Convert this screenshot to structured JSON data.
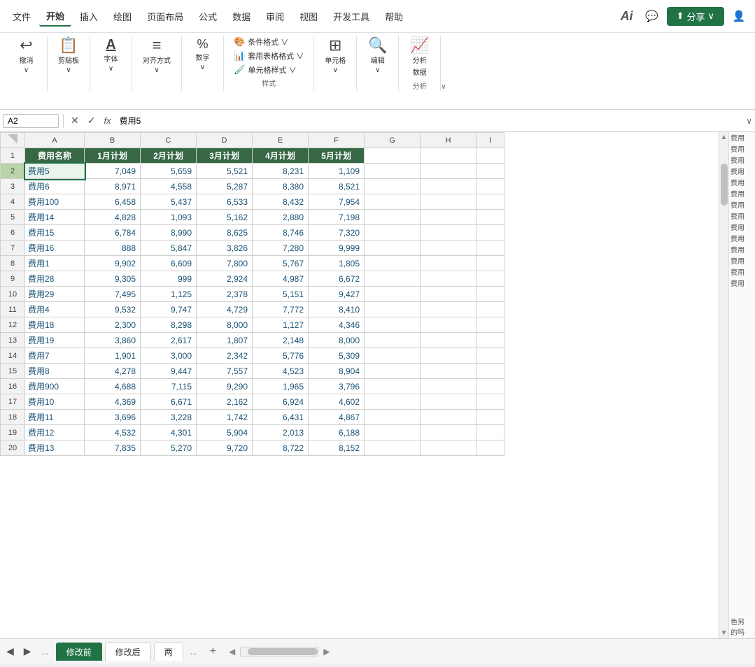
{
  "titlebar": {
    "menu_items": [
      "文件",
      "开始",
      "插入",
      "绘图",
      "页面布局",
      "公式",
      "数据",
      "审阅",
      "视图",
      "开发工具",
      "帮助"
    ],
    "active_menu": "开始",
    "ai_label": "Ai",
    "share_label": "分享",
    "user_icon": "👤"
  },
  "ribbon": {
    "groups": [
      {
        "id": "undo",
        "label": "撤消",
        "items": [
          {
            "icon": "↩",
            "label": "撤消"
          }
        ]
      },
      {
        "id": "clipboard",
        "label": "剪贴板",
        "items": [
          {
            "icon": "📋",
            "label": "剪贴板"
          }
        ]
      },
      {
        "id": "font",
        "label": "字体",
        "items": [
          {
            "icon": "A",
            "label": "字体"
          }
        ]
      },
      {
        "id": "alignment",
        "label": "对齐方式",
        "items": [
          {
            "icon": "≡",
            "label": "对齐方式"
          }
        ]
      },
      {
        "id": "number",
        "label": "数字",
        "items": [
          {
            "icon": "%",
            "label": "数字"
          }
        ]
      },
      {
        "id": "styles",
        "label": "样式",
        "rows": [
          {
            "icon": "🎨",
            "label": "条件格式 ∨"
          },
          {
            "icon": "📊",
            "label": "套用表格格式 ∨"
          },
          {
            "icon": "🖌",
            "label": "单元格样式 ∨"
          }
        ]
      },
      {
        "id": "cells",
        "label": "单元格",
        "items": [
          {
            "icon": "⊞",
            "label": "单元格"
          }
        ]
      },
      {
        "id": "editing",
        "label": "编辑",
        "items": [
          {
            "icon": "🔍",
            "label": "编辑"
          }
        ]
      },
      {
        "id": "analysis",
        "label": "分析",
        "items": [
          {
            "icon": "📈",
            "label": "分析数据"
          }
        ]
      }
    ]
  },
  "formula_bar": {
    "cell_ref": "A2",
    "formula_value": "费用5",
    "fx_label": "fx"
  },
  "spreadsheet": {
    "col_headers": [
      "A",
      "B",
      "C",
      "D",
      "E",
      "F",
      "G",
      "H",
      "I"
    ],
    "row_count": 20,
    "headers": [
      "费用名称",
      "1月计划",
      "2月计划",
      "3月计划",
      "4月计划",
      "5月计划"
    ],
    "rows": [
      [
        "费用5",
        "7,049",
        "5,659",
        "5,521",
        "8,231",
        "1,109"
      ],
      [
        "费用6",
        "8,971",
        "4,558",
        "5,287",
        "8,380",
        "8,521"
      ],
      [
        "费用100",
        "6,458",
        "5,437",
        "6,533",
        "8,432",
        "7,954"
      ],
      [
        "费用14",
        "4,828",
        "1,093",
        "5,162",
        "2,880",
        "7,198"
      ],
      [
        "费用15",
        "6,784",
        "8,990",
        "8,625",
        "8,746",
        "7,320"
      ],
      [
        "费用16",
        "888",
        "5,847",
        "3,826",
        "7,280",
        "9,999"
      ],
      [
        "费用1",
        "9,902",
        "6,609",
        "7,800",
        "5,767",
        "1,805"
      ],
      [
        "费用28",
        "9,305",
        "999",
        "2,924",
        "4,987",
        "6,672"
      ],
      [
        "费用29",
        "7,495",
        "1,125",
        "2,378",
        "5,151",
        "9,427"
      ],
      [
        "费用4",
        "9,532",
        "9,747",
        "4,729",
        "7,772",
        "8,410"
      ],
      [
        "费用18",
        "2,300",
        "8,298",
        "8,000",
        "1,127",
        "4,346"
      ],
      [
        "费用19",
        "3,860",
        "2,617",
        "1,807",
        "2,148",
        "8,000"
      ],
      [
        "费用7",
        "1,901",
        "3,000",
        "2,342",
        "5,776",
        "5,309"
      ],
      [
        "费用8",
        "4,278",
        "9,447",
        "7,557",
        "4,523",
        "8,904"
      ],
      [
        "费用900",
        "4,688",
        "7,115",
        "9,290",
        "1,965",
        "3,796"
      ],
      [
        "费用10",
        "4,369",
        "6,671",
        "2,162",
        "6,924",
        "4,602"
      ],
      [
        "费用11",
        "3,696",
        "3,228",
        "1,742",
        "6,431",
        "4,867"
      ],
      [
        "费用12",
        "4,532",
        "4,301",
        "5,904",
        "2,013",
        "6,188"
      ],
      [
        "费用13",
        "7,835",
        "5,270",
        "9,720",
        "8,722",
        "8,152"
      ]
    ],
    "selected_cell": "A2",
    "selected_row": 2
  },
  "sheet_tabs": {
    "tabs": [
      "修改前",
      "修改后",
      "两"
    ],
    "active_tab": "修改前",
    "add_label": "+",
    "dots_label": "..."
  },
  "right_sidebar": {
    "items": [
      "费用",
      "费用",
      "费用",
      "费用",
      "费用",
      "费用",
      "费用",
      "费用",
      "费用",
      "费用",
      "费用",
      "费用",
      "费用",
      "费用"
    ],
    "bottom_items": [
      "色另",
      "的吗"
    ]
  }
}
